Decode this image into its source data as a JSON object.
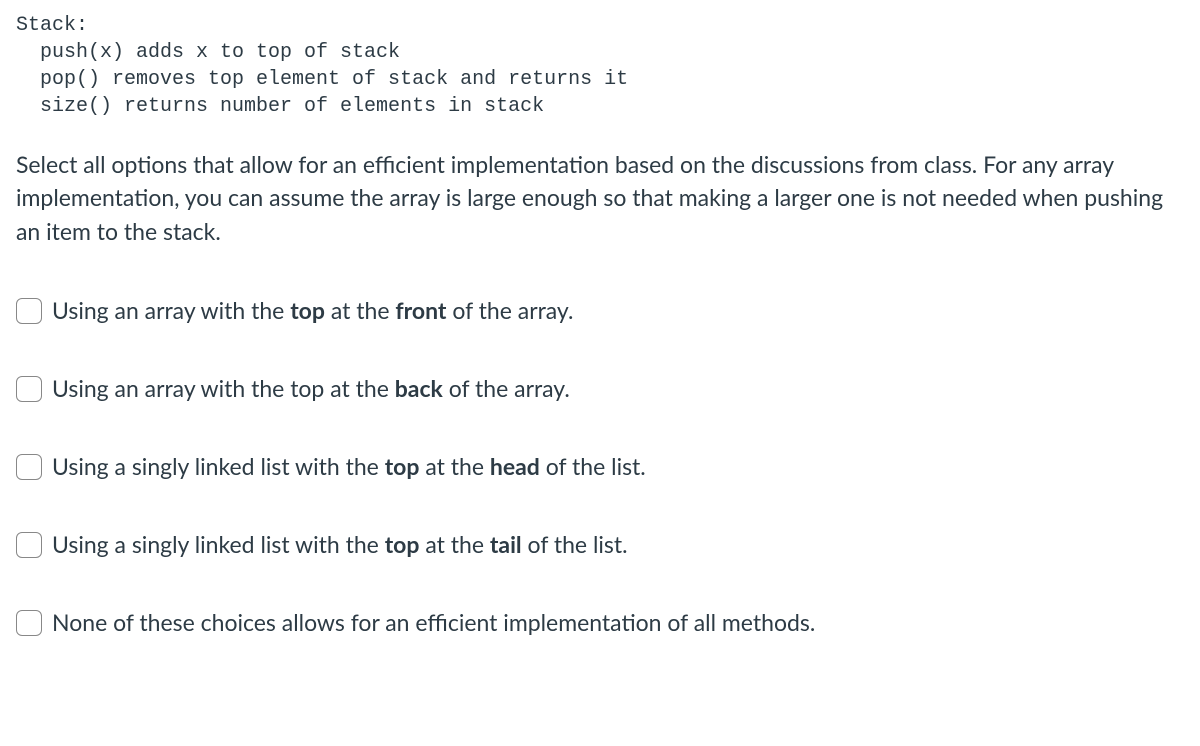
{
  "code": {
    "l1": "Stack:",
    "l2": "  push(x) adds x to top of stack",
    "l3": "  pop() removes top element of stack and returns it",
    "l4": "  size() returns number of elements in stack"
  },
  "question": "Select all options that allow for an efficient implementation based on the discussions from class. For any array implementation, you can assume the array is large enough so that making a larger one is not needed when pushing an item to the stack.",
  "options": [
    {
      "pre": "Using an array with the ",
      "b1": "top",
      "mid1": " at the ",
      "b2": "front",
      "post": " of the array."
    },
    {
      "pre": "Using an array with the top at the ",
      "b1": "back",
      "mid1": "",
      "b2": "",
      "post": " of the array."
    },
    {
      "pre": "Using a singly linked list with the ",
      "b1": "top",
      "mid1": " at the ",
      "b2": "head",
      "post": " of the list."
    },
    {
      "pre": "Using a singly linked list with the ",
      "b1": "top",
      "mid1": " at the ",
      "b2": "tail",
      "post": " of the list."
    },
    {
      "pre": "None of these choices allows for an efficient implementation of all methods.",
      "b1": "",
      "mid1": "",
      "b2": "",
      "post": ""
    }
  ]
}
